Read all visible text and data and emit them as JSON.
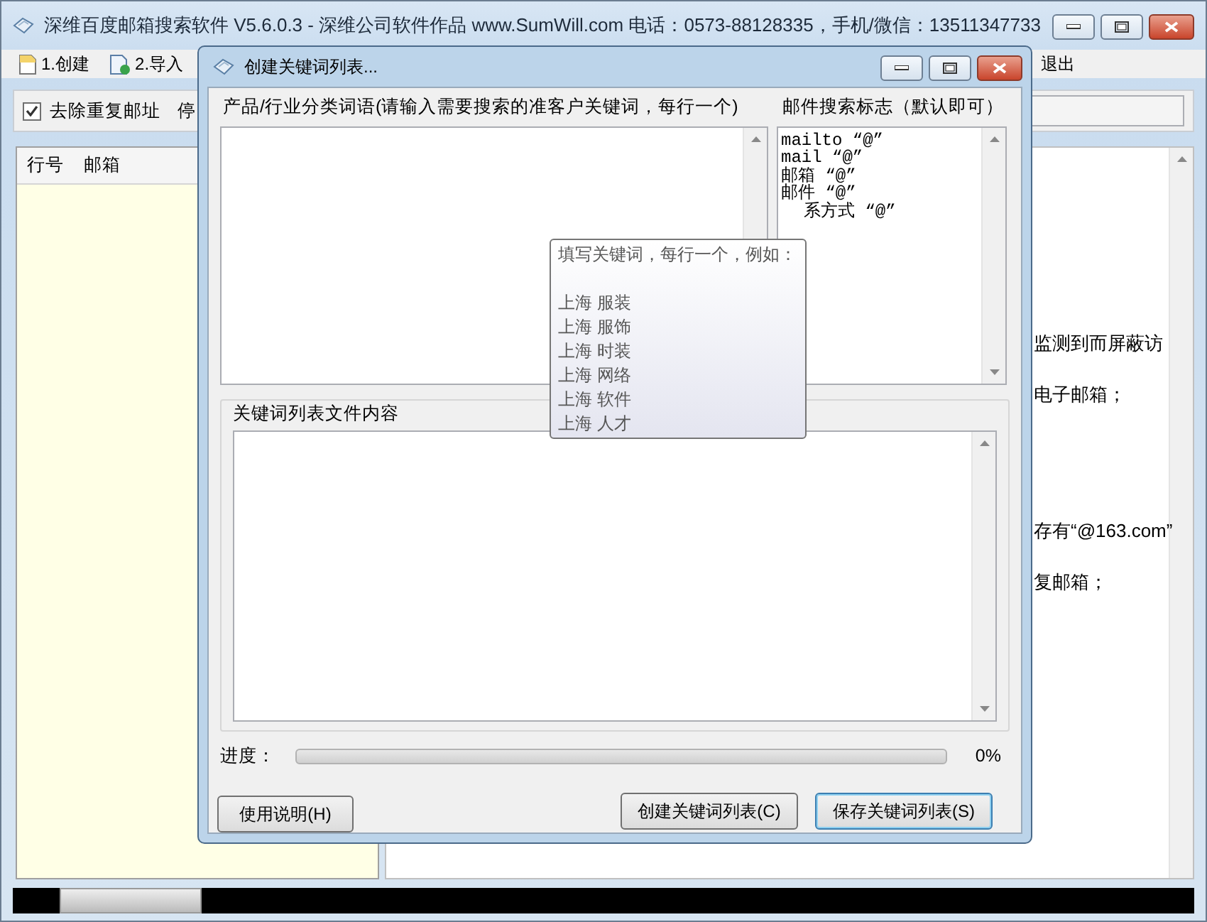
{
  "window": {
    "title": "深维百度邮箱搜索软件 V5.6.0.3 - 深维公司软件作品 www.SumWill.com  电话：0573-88128335，手机/微信：13511347733"
  },
  "toolbar": [
    {
      "label": "1.创建",
      "kind": "new"
    },
    {
      "label": "2.导入",
      "kind": "import"
    },
    {
      "label": "退出",
      "kind": "plain"
    }
  ],
  "options": {
    "dedupe": {
      "label": "去除重复邮址",
      "checked": true
    },
    "label_2": "停"
  },
  "left_table": {
    "columns": [
      "行号",
      "邮箱"
    ]
  },
  "right_pane": {
    "lines": [
      "监测到而屏蔽访",
      "电子邮箱；",
      "存有“@163.com”",
      "复邮箱；"
    ]
  },
  "dialog": {
    "title": "创建关键词列表...",
    "keywords_label": "产品/行业分类词语(请输入需要搜索的准客户关键词，每行一个)",
    "flags_label": "邮件搜索标志（默认即可）",
    "flags": [
      {
        "text": "mailto “@”",
        "kind": "full"
      },
      {
        "text": "mail “@”",
        "kind": "full"
      },
      {
        "text": "邮箱 “@”",
        "kind": "full"
      },
      {
        "text": "邮件 “@”",
        "kind": "full"
      },
      {
        "text": "系方式 “@”",
        "kind": "partial"
      }
    ],
    "tooltip": {
      "heading": "填写关键词，每行一个，例如：",
      "examples": [
        "上海 服装",
        "上海 服饰",
        "上海 时装",
        "上海 网络",
        "上海 软件",
        "上海 人才"
      ]
    },
    "file_content_label": "关键词列表文件内容",
    "progress": {
      "label": "进度：",
      "level": 0,
      "reading": "0%"
    },
    "buttons": [
      {
        "label": "使用说明(H)",
        "default": false
      },
      {
        "label": "创建关键词列表(C)",
        "default": false
      },
      {
        "label": "保存关键词列表(S)",
        "default": true
      }
    ]
  }
}
